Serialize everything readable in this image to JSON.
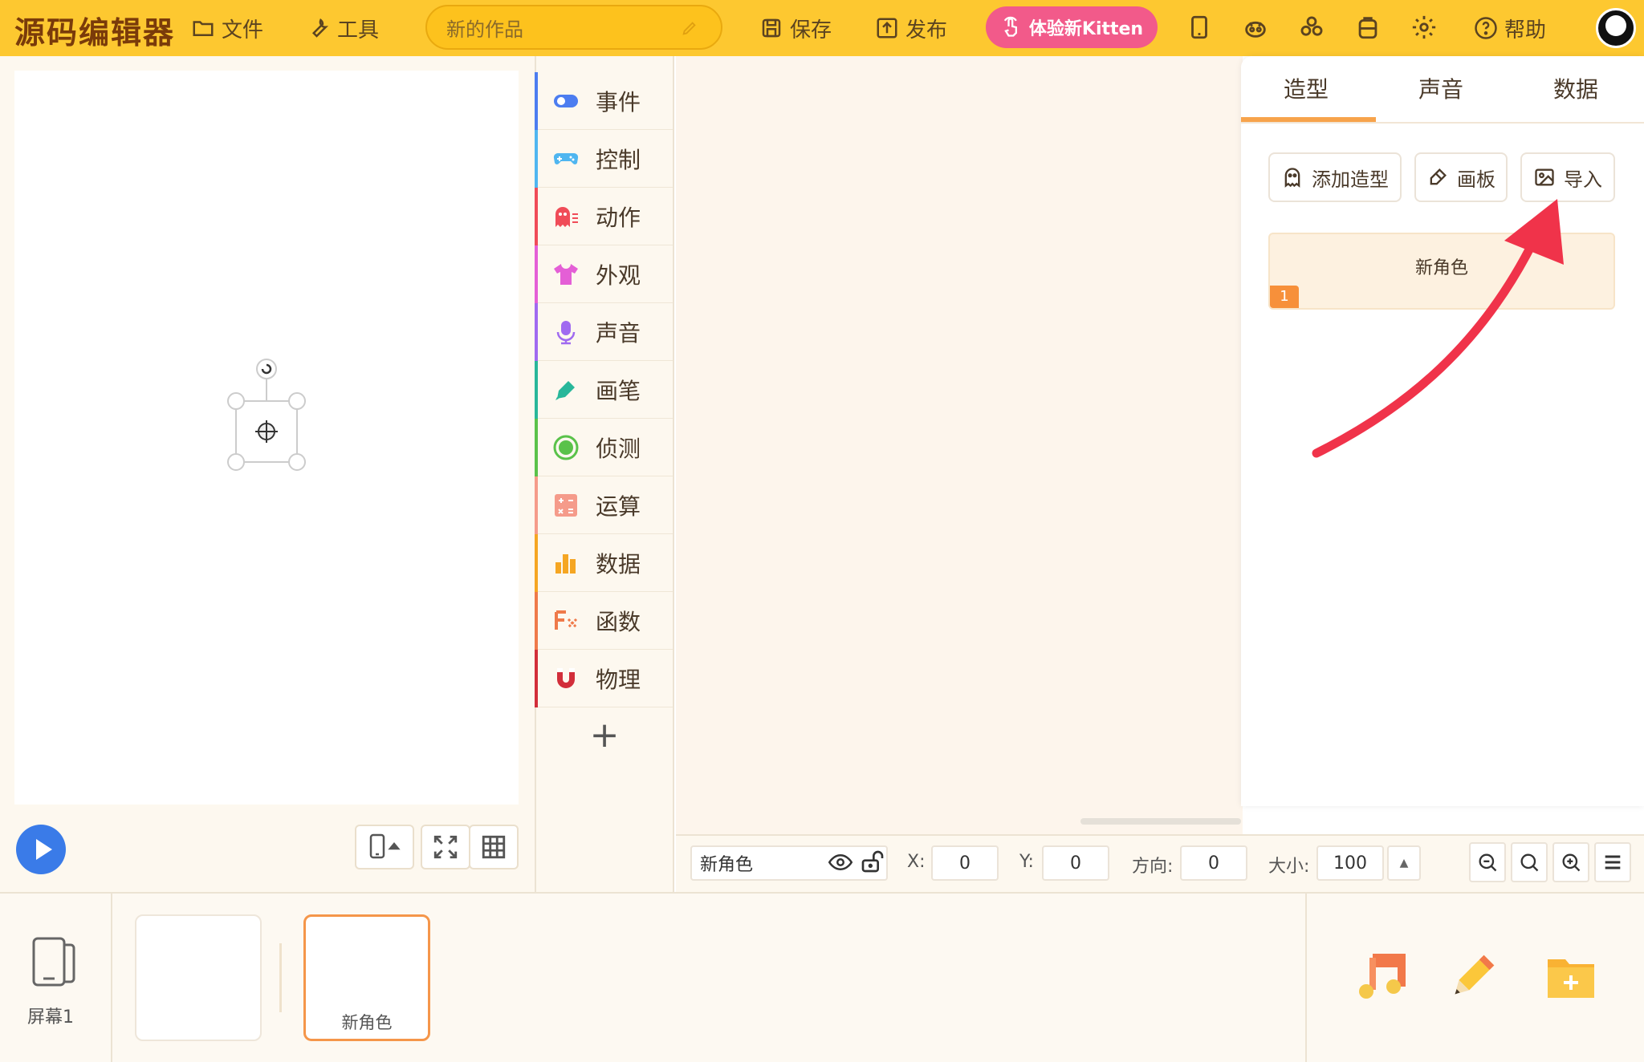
{
  "app": {
    "logo": "源码编辑器"
  },
  "topbar": {
    "file_label": "文件",
    "tools_label": "工具",
    "project_title": "新的作品",
    "save_label": "保存",
    "publish_label": "发布",
    "kitten_label": "体验新Kitten",
    "help_label": "帮助"
  },
  "categories": [
    {
      "label": "事件",
      "icon": "toggle-icon",
      "color": "#4c7df0"
    },
    {
      "label": "控制",
      "icon": "gamepad-icon",
      "color": "#4fb6f0"
    },
    {
      "label": "动作",
      "icon": "ghost-icon",
      "color": "#f04c58"
    },
    {
      "label": "外观",
      "icon": "shirt-icon",
      "color": "#e45fd6"
    },
    {
      "label": "声音",
      "icon": "microphone-icon",
      "color": "#a06af0"
    },
    {
      "label": "画笔",
      "icon": "pen-icon",
      "color": "#28b79a"
    },
    {
      "label": "侦测",
      "icon": "target-icon",
      "color": "#5ac24a"
    },
    {
      "label": "运算",
      "icon": "calculator-icon",
      "color": "#f59b8a"
    },
    {
      "label": "数据",
      "icon": "bar-chart-icon",
      "color": "#f5a623"
    },
    {
      "label": "函数",
      "icon": "function-icon",
      "color": "#ef7a4a"
    },
    {
      "label": "物理",
      "icon": "magnet-icon",
      "color": "#d22e3a"
    }
  ],
  "panel": {
    "tabs": [
      "造型",
      "声音",
      "数据"
    ],
    "active_tab": "造型",
    "add_costume_label": "添加造型",
    "drawboard_label": "画板",
    "import_label": "导入",
    "costume": {
      "name": "新角色",
      "index": "1"
    }
  },
  "props": {
    "sprite_name": "新角色",
    "x_label": "X:",
    "x_value": "0",
    "y_label": "Y:",
    "y_value": "0",
    "dir_label": "方向:",
    "dir_value": "0",
    "size_label": "大小:",
    "size_value": "100"
  },
  "bottom": {
    "screen_label": "屏幕1",
    "sprite_label": "新角色"
  },
  "colors": {
    "topbar": "#fdc830",
    "accent": "#f5964a",
    "kitten": "#f25a8a",
    "arrow": "#f0334a"
  }
}
